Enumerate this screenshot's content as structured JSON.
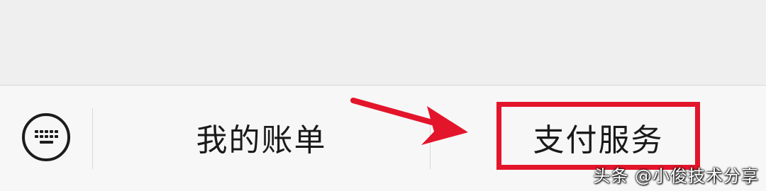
{
  "menu": {
    "keyboard_icon": "keyboard-icon",
    "items": [
      {
        "label": "我的账单"
      },
      {
        "label": "支付服务"
      }
    ]
  },
  "annotation": {
    "highlight_color": "#e3152b",
    "highlighted_item": "支付服务"
  },
  "watermark": {
    "text": "头条 @小俊技术分享"
  }
}
